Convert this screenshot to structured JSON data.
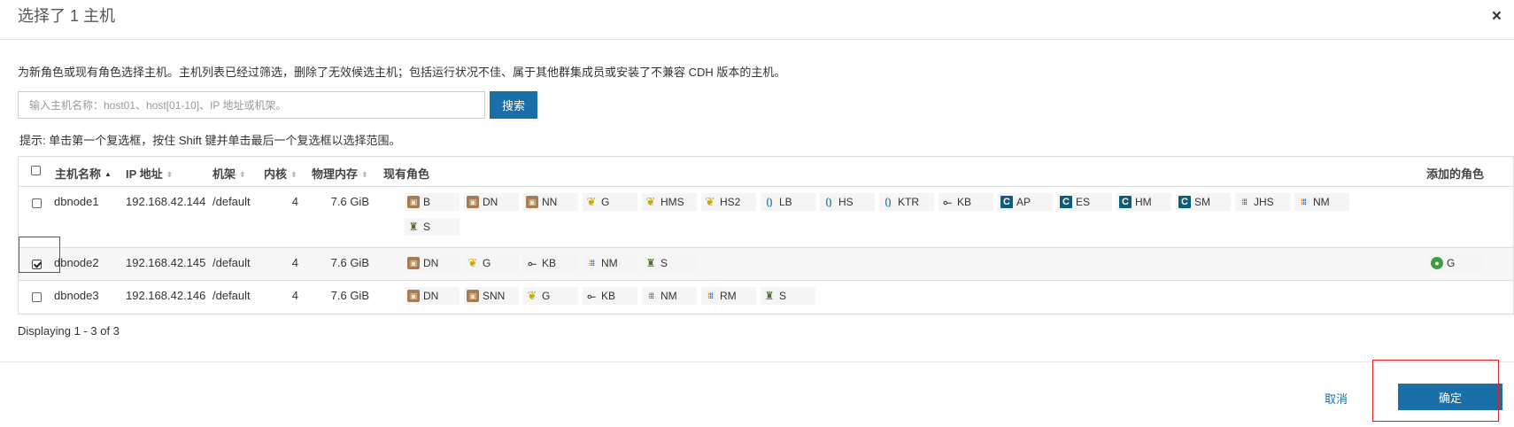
{
  "dialog": {
    "title": "选择了 1 主机",
    "close_glyph": "×",
    "description": "为新角色或现有角色选择主机。主机列表已经过筛选，删除了无效候选主机；包括运行状况不佳、属于其他群集成员或安装了不兼容 CDH 版本的主机。",
    "search": {
      "placeholder": "输入主机名称：host01、host[01-10]、IP 地址或机架。",
      "value": "",
      "button_label": "搜索"
    },
    "hint": "提示: 单击第一个复选框，按住 Shift 键并单击最后一个复选框以选择范围。",
    "table": {
      "headers": {
        "hostname": "主机名称",
        "ip": "IP 地址",
        "rack": "机架",
        "cores": "内核",
        "memory": "物理内存",
        "existing_roles": "现有角色",
        "added_roles": "添加的角色"
      },
      "sort_asc_glyph": "▲",
      "sort_none_glyph": "⬍",
      "rows": [
        {
          "checked": false,
          "hostname": "dbnode1",
          "ip": "192.168.42.144",
          "rack": "/default",
          "cores": "4",
          "memory": "7.6 GiB",
          "roles": [
            {
              "label": "B",
              "icon": "hdfs-icon"
            },
            {
              "label": "DN",
              "icon": "hdfs-icon"
            },
            {
              "label": "NN",
              "icon": "hdfs-icon"
            },
            {
              "label": "G",
              "icon": "hive-icon"
            },
            {
              "label": "HMS",
              "icon": "hive-icon"
            },
            {
              "label": "HS2",
              "icon": "hive-icon"
            },
            {
              "label": "LB",
              "icon": "hue-icon"
            },
            {
              "label": "HS",
              "icon": "hue-icon"
            },
            {
              "label": "KTR",
              "icon": "hue-icon"
            },
            {
              "label": "KB",
              "icon": "kafka-icon"
            },
            {
              "label": "AP",
              "icon": "cm-icon"
            },
            {
              "label": "ES",
              "icon": "cm-icon"
            },
            {
              "label": "HM",
              "icon": "cm-icon"
            },
            {
              "label": "SM",
              "icon": "cm-icon"
            },
            {
              "label": "JHS",
              "icon": "yarn-icon"
            },
            {
              "label": "NM",
              "icon": "yarn-icon"
            },
            {
              "label": "S",
              "icon": "zookeeper-icon"
            }
          ],
          "added": []
        },
        {
          "checked": true,
          "hostname": "dbnode2",
          "ip": "192.168.42.145",
          "rack": "/default",
          "cores": "4",
          "memory": "7.6 GiB",
          "roles": [
            {
              "label": "DN",
              "icon": "hdfs-icon"
            },
            {
              "label": "G",
              "icon": "hive-icon"
            },
            {
              "label": "KB",
              "icon": "kafka-icon"
            },
            {
              "label": "NM",
              "icon": "yarn-icon"
            },
            {
              "label": "S",
              "icon": "zookeeper-icon"
            }
          ],
          "added": [
            {
              "label": "G",
              "icon": "gateway-icon"
            }
          ]
        },
        {
          "checked": false,
          "hostname": "dbnode3",
          "ip": "192.168.42.146",
          "rack": "/default",
          "cores": "4",
          "memory": "7.6 GiB",
          "roles": [
            {
              "label": "DN",
              "icon": "hdfs-icon"
            },
            {
              "label": "SNN",
              "icon": "hdfs-icon"
            },
            {
              "label": "G",
              "icon": "hive-icon"
            },
            {
              "label": "KB",
              "icon": "kafka-icon"
            },
            {
              "label": "NM",
              "icon": "yarn-icon"
            },
            {
              "label": "RM",
              "icon": "yarn-icon"
            },
            {
              "label": "S",
              "icon": "zookeeper-icon"
            }
          ],
          "added": []
        }
      ]
    },
    "display_count": "Displaying 1 - 3 of 3",
    "footer": {
      "cancel_label": "取消",
      "confirm_label": "确定"
    },
    "colors": {
      "accent": "#1a6fa8",
      "highlight_border": "#e02020"
    }
  }
}
